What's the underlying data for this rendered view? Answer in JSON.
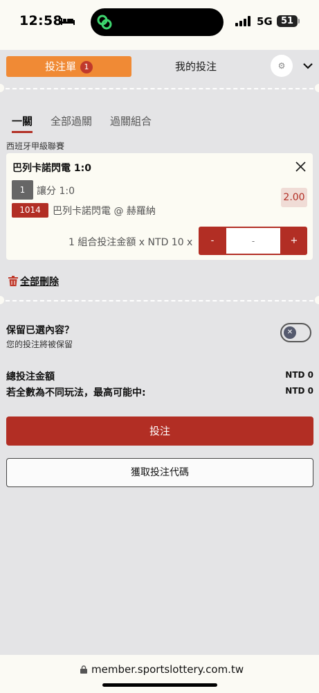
{
  "status_bar": {
    "time": "12:58",
    "network": "5G",
    "battery": "51"
  },
  "header": {
    "tab_bet_slip": "投注單",
    "bet_slip_count": "1",
    "tab_my_bets": "我的投注"
  },
  "sub_tabs": [
    "一關",
    "全部過關",
    "過關組合"
  ],
  "league": "西班牙甲級聯賽",
  "bet": {
    "match": "巴列卡諾閃電 1:0",
    "selection_num": "1",
    "market": "讓分 1:0",
    "odds": "2.00",
    "code": "1014",
    "pick": "巴列卡諾閃電 @ 赫羅納",
    "stake_label": "1 組合投注金額 x NTD 10 x",
    "stepper_minus": "-",
    "stepper_plus": "+",
    "stake_placeholder": "-"
  },
  "delete_all": "全部刪除",
  "keep_selections": {
    "title": "保留已選內容？",
    "subtitle": "您的投注將被保留"
  },
  "summary": {
    "total_label": "總投注金額",
    "total_value": "NTD 0",
    "max_win_label": "若全數為不同玩法，最高可能中:",
    "max_win_value": "NTD 0"
  },
  "buttons": {
    "place_bet": "投注",
    "get_code": "獲取投注代碼"
  },
  "browser": {
    "url": "member.sportslottery.com.tw"
  },
  "colors": {
    "accent_orange": "#f08a35",
    "brand_red": "#b22e24",
    "background": "#e4e4e6"
  }
}
